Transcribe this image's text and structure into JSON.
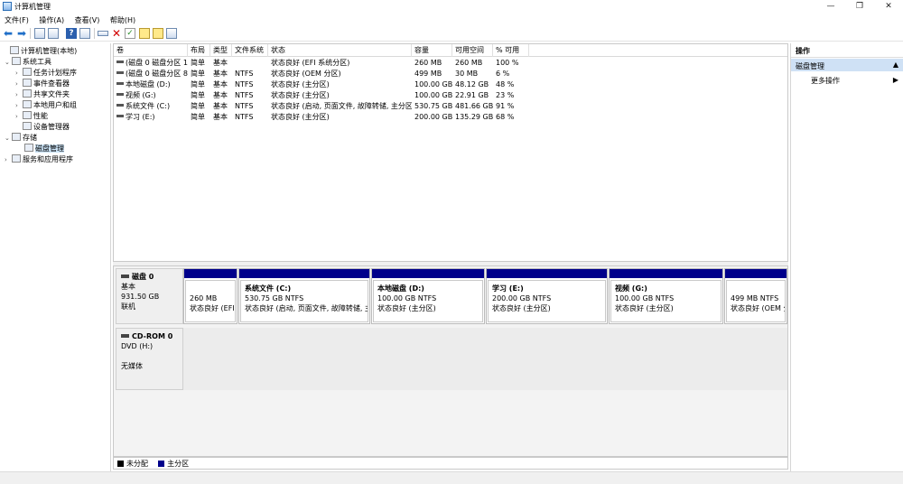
{
  "window": {
    "title": "计算机管理",
    "icons": {
      "app": "computer-management-icon",
      "minimize": "minimize-icon",
      "maximize": "restore-icon",
      "close": "close-icon"
    },
    "controls": {
      "minimize": "—",
      "restore": "❐",
      "close": "✕"
    }
  },
  "menu": [
    "文件(F)",
    "操作(A)",
    "查看(V)",
    "帮助(H)"
  ],
  "tree": {
    "items": [
      {
        "label": "计算机管理(本地)",
        "expander": "",
        "icon": "computer-icon"
      },
      {
        "label": "系统工具",
        "expander": "⌄",
        "icon": "tools-icon"
      },
      {
        "label": "任务计划程序",
        "expander": "›",
        "icon": "task-scheduler-icon"
      },
      {
        "label": "事件查看器",
        "expander": "›",
        "icon": "event-viewer-icon"
      },
      {
        "label": "共享文件夹",
        "expander": "›",
        "icon": "shared-folder-icon"
      },
      {
        "label": "本地用户和组",
        "expander": "›",
        "icon": "users-icon"
      },
      {
        "label": "性能",
        "expander": "›",
        "icon": "performance-icon"
      },
      {
        "label": "设备管理器",
        "expander": "",
        "icon": "device-manager-icon"
      },
      {
        "label": "存储",
        "expander": "⌄",
        "icon": "storage-icon"
      },
      {
        "label": "磁盘管理",
        "expander": "",
        "icon": "disk-management-icon"
      },
      {
        "label": "服务和应用程序",
        "expander": "›",
        "icon": "services-icon"
      }
    ]
  },
  "volumes": {
    "columns": [
      "卷",
      "布局",
      "类型",
      "文件系统",
      "状态",
      "容量",
      "可用空间",
      "% 可用"
    ],
    "rows": [
      [
        "(磁盘 0 磁盘分区 1)",
        "简单",
        "基本",
        "",
        "状态良好 (EFI 系统分区)",
        "260 MB",
        "260 MB",
        "100 %"
      ],
      [
        "(磁盘 0 磁盘分区 8)",
        "简单",
        "基本",
        "NTFS",
        "状态良好 (OEM 分区)",
        "499 MB",
        "30 MB",
        "6 %"
      ],
      [
        "本地磁盘 (D:)",
        "简单",
        "基本",
        "NTFS",
        "状态良好 (主分区)",
        "100.00 GB",
        "48.12 GB",
        "48 %"
      ],
      [
        "视频 (G:)",
        "简单",
        "基本",
        "NTFS",
        "状态良好 (主分区)",
        "100.00 GB",
        "22.91 GB",
        "23 %"
      ],
      [
        "系统文件 (C:)",
        "简单",
        "基本",
        "NTFS",
        "状态良好 (启动, 页面文件, 故障转储, 主分区)",
        "530.75 GB",
        "481.66 GB",
        "91 %"
      ],
      [
        "学习 (E:)",
        "简单",
        "基本",
        "NTFS",
        "状态良好 (主分区)",
        "200.00 GB",
        "135.29 GB",
        "68 %"
      ]
    ]
  },
  "disks": {
    "disk0": {
      "name": "磁盘 0",
      "type": "基本",
      "size": "931.50 GB",
      "status": "联机",
      "partitions": [
        {
          "name": "",
          "size": "260 MB",
          "status": "状态良好 (EFI 系"
        },
        {
          "name": "系统文件 (C:)",
          "size": "530.75 GB NTFS",
          "status": "状态良好 (启动, 页面文件, 故障转储, 主分"
        },
        {
          "name": "本地磁盘 (D:)",
          "size": "100.00 GB NTFS",
          "status": "状态良好 (主分区)"
        },
        {
          "name": "学习 (E:)",
          "size": "200.00 GB NTFS",
          "status": "状态良好 (主分区)"
        },
        {
          "name": "视频 (G:)",
          "size": "100.00 GB NTFS",
          "status": "状态良好 (主分区)"
        },
        {
          "name": "",
          "size": "499 MB NTFS",
          "status": "状态良好 (OEM 分"
        }
      ]
    },
    "cdrom0": {
      "name": "CD-ROM 0",
      "type": "DVD (H:)",
      "media": "无媒体"
    }
  },
  "legend": [
    {
      "label": "未分配",
      "color": "#000000"
    },
    {
      "label": "主分区",
      "color": "#00008b"
    }
  ],
  "actions": {
    "header": "操作",
    "section": "磁盘管理",
    "more": "更多操作"
  }
}
